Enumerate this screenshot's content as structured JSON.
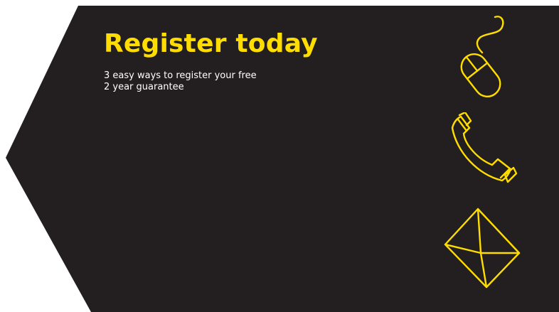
{
  "banner": {
    "headline": "Register today",
    "subtext_line1": "3 easy ways to register your free",
    "subtext_line2": "2 year guarantee"
  },
  "icons": [
    "mouse-icon",
    "phone-icon",
    "envelope-icon"
  ],
  "colors": {
    "background": "#231f20",
    "accent": "#ffdd00",
    "text": "#ffffff",
    "page": "#ffffff"
  }
}
